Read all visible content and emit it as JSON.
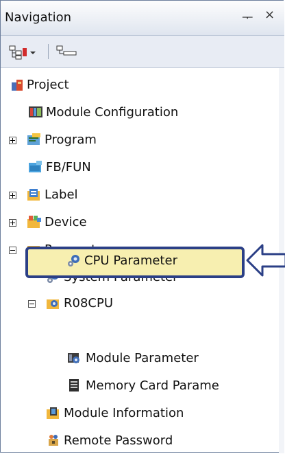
{
  "window": {
    "title": "Navigation",
    "pin_glyph": "ᅮ",
    "close_glyph": "×"
  },
  "toolbar": {
    "buttons": [
      {
        "icon": "expand-collapse-dropdown-icon"
      },
      {
        "icon": "tree-view-icon"
      }
    ]
  },
  "tree": {
    "items": [
      {
        "label": "Project",
        "icon": "project-icon",
        "expander": "none"
      },
      {
        "label": "Module Configuration",
        "icon": "module-configuration-icon",
        "expander": "none"
      },
      {
        "label": "Program",
        "icon": "program-icon",
        "expander": "plus"
      },
      {
        "label": "FB/FUN",
        "icon": "fb-fun-icon",
        "expander": "none"
      },
      {
        "label": "Label",
        "icon": "label-icon",
        "expander": "plus"
      },
      {
        "label": "Device",
        "icon": "device-icon",
        "expander": "plus"
      },
      {
        "label": "Parameter",
        "icon": "parameter-icon",
        "expander": "minus"
      },
      {
        "label": "System Parameter",
        "icon": "system-parameter-icon",
        "expander": "none"
      },
      {
        "label": "R08CPU",
        "icon": "cpu-folder-icon",
        "expander": "minus"
      },
      {
        "label": "CPU Parameter",
        "icon": "cpu-parameter-icon",
        "expander": "none",
        "selected": true
      },
      {
        "label": "Module Parameter",
        "icon": "module-parameter-icon",
        "expander": "none"
      },
      {
        "label": "Memory Card Parame",
        "icon": "memory-card-icon",
        "expander": "none"
      },
      {
        "label": "Module Information",
        "icon": "module-information-icon",
        "expander": "none"
      },
      {
        "label": "Remote Password",
        "icon": "remote-password-icon",
        "expander": "none"
      }
    ]
  },
  "colors": {
    "selection_border": "#2b3f86",
    "selection_fill": "#f7efb0"
  }
}
